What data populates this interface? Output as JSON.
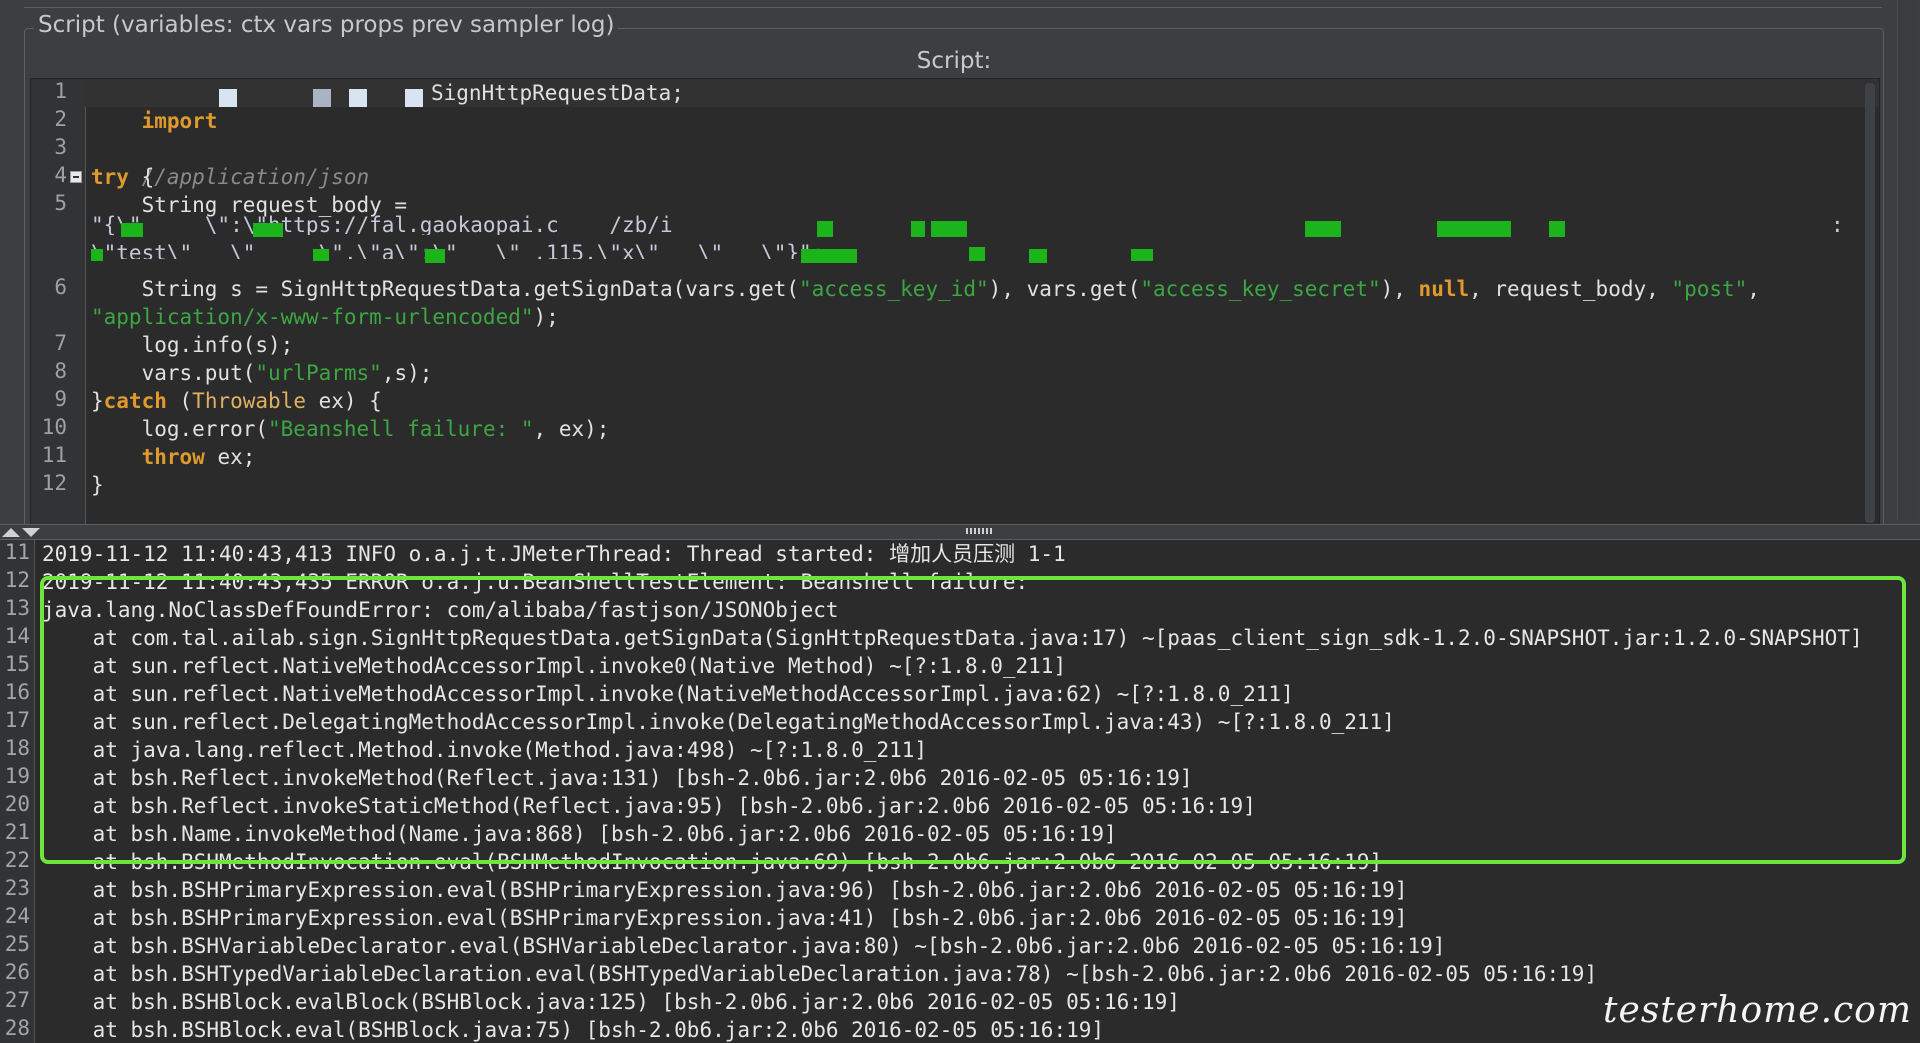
{
  "panel": {
    "group_title": "Script (variables: ctx vars props prev sampler log)",
    "script_label": "Script:"
  },
  "editor": {
    "line_numbers": [
      "1",
      "2",
      "3",
      "4",
      "5",
      "6",
      "7",
      "8",
      "9",
      "10",
      "11",
      "12"
    ],
    "line1": {
      "kw": "import",
      "rest": "SignHttpRequestData;"
    },
    "line3": {
      "comment": "//application/json"
    },
    "line4": {
      "kw": "try",
      "rest": " {"
    },
    "line5": {
      "text": "    String request_body ="
    },
    "line5_wrap1": "\"{\\\"     \\\":\\\"https://fal.gaokaopai.c    /zb/i",
    "line5_wrap1_end": ":",
    "line5_wrap2": "\\\"test\\\"   \\\"     \\\",\\\"a\\\":\\\"   \\\" .115,\\\"x\\\"   \\\"   \\\"}\";",
    "line6": {
      "a": "    String s = SignHttpRequestData.getSignData(vars.get(",
      "s1": "\"access_key_id\"",
      "b": "), vars.get(",
      "s2": "\"access_key_secret\"",
      "c": "), ",
      "kw": "null",
      "d": ", request_body, ",
      "s3": "\"post\"",
      "e": ","
    },
    "line6_wrap": {
      "s": "\"application/x-www-form-urlencoded\"",
      "e": ");"
    },
    "line7": "    log.info(s);",
    "line8": {
      "a": "    vars.put(",
      "s": "\"urlParms\"",
      "b": ",s);"
    },
    "line9": {
      "a": "}",
      "kw": "catch",
      "b": " (",
      "cls": "Throwable",
      "c": " ex) {"
    },
    "line10": {
      "a": "    log.error(",
      "s": "\"Beanshell failure: \"",
      "b": ", ex);"
    },
    "line11": {
      "kw": "throw",
      "rest": " ex;"
    },
    "line12": "}"
  },
  "console": {
    "line_numbers": [
      "11",
      "12",
      "13",
      "14",
      "15",
      "16",
      "17",
      "18",
      "19",
      "20",
      "21",
      "22",
      "23",
      "24",
      "25",
      "26",
      "27",
      "28"
    ],
    "lines": [
      "2019-11-12 11:40:43,413 INFO o.a.j.t.JMeterThread: Thread started: 增加人员压测 1-1",
      "2019-11-12 11:40:43,435 ERROR o.a.j.u.BeanShellTestElement: Beanshell failure:",
      "java.lang.NoClassDefFoundError: com/alibaba/fastjson/JSONObject",
      "    at com.tal.ailab.sign.SignHttpRequestData.getSignData(SignHttpRequestData.java:17) ~[paas_client_sign_sdk-1.2.0-SNAPSHOT.jar:1.2.0-SNAPSHOT]",
      "    at sun.reflect.NativeMethodAccessorImpl.invoke0(Native Method) ~[?:1.8.0_211]",
      "    at sun.reflect.NativeMethodAccessorImpl.invoke(NativeMethodAccessorImpl.java:62) ~[?:1.8.0_211]",
      "    at sun.reflect.DelegatingMethodAccessorImpl.invoke(DelegatingMethodAccessorImpl.java:43) ~[?:1.8.0_211]",
      "    at java.lang.reflect.Method.invoke(Method.java:498) ~[?:1.8.0_211]",
      "    at bsh.Reflect.invokeMethod(Reflect.java:131) [bsh-2.0b6.jar:2.0b6 2016-02-05 05:16:19]",
      "    at bsh.Reflect.invokeStaticMethod(Reflect.java:95) [bsh-2.0b6.jar:2.0b6 2016-02-05 05:16:19]",
      "    at bsh.Name.invokeMethod(Name.java:868) [bsh-2.0b6.jar:2.0b6 2016-02-05 05:16:19]",
      "    at bsh.BSHMethodInvocation.eval(BSHMethodInvocation.java:69) [bsh-2.0b6.jar:2.0b6 2016-02-05 05:16:19]",
      "    at bsh.BSHPrimaryExpression.eval(BSHPrimaryExpression.java:96) [bsh-2.0b6.jar:2.0b6 2016-02-05 05:16:19]",
      "    at bsh.BSHPrimaryExpression.eval(BSHPrimaryExpression.java:41) [bsh-2.0b6.jar:2.0b6 2016-02-05 05:16:19]",
      "    at bsh.BSHVariableDeclarator.eval(BSHVariableDeclarator.java:80) ~[bsh-2.0b6.jar:2.0b6 2016-02-05 05:16:19]",
      "    at bsh.BSHTypedVariableDeclaration.eval(BSHTypedVariableDeclaration.java:78) ~[bsh-2.0b6.jar:2.0b6 2016-02-05 05:16:19]",
      "    at bsh.BSHBlock.evalBlock(BSHBlock.java:125) [bsh-2.0b6.jar:2.0b6 2016-02-05 05:16:19]",
      "    at bsh.BSHBlock.eval(BSHBlock.java:75) [bsh-2.0b6.jar:2.0b6 2016-02-05 05:16:19]"
    ]
  },
  "watermark": "testerhome.com",
  "colors": {
    "background": "#3c3f41",
    "editor_bg": "#2b2b2b",
    "keyword": "#e09a2c",
    "string": "#3ca642",
    "highlight_box": "#6ee43c",
    "redaction": "#1bb51b"
  }
}
